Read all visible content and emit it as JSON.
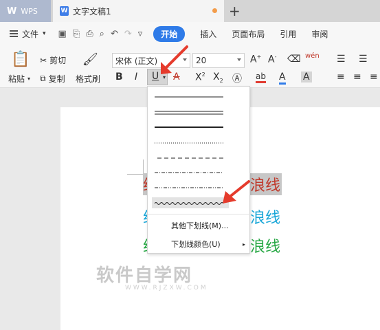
{
  "titlebar": {
    "app_tab": "WPS",
    "doc_tab": "文字文稿1",
    "doc_icon_letter": "W",
    "add_tab": "+"
  },
  "menubar": {
    "file": "文件",
    "tabs": [
      "开始",
      "插入",
      "页面布局",
      "引用",
      "审阅"
    ]
  },
  "ribbon": {
    "paste": "粘贴",
    "cut": "剪切",
    "copy": "复制",
    "format_painter": "格式刷",
    "font_name": "宋体 (正文)",
    "font_size": "20",
    "bold": "B",
    "italic": "I",
    "underline": "U",
    "phonetic": "wén"
  },
  "underline_menu": {
    "styles": [
      "single",
      "double-thin",
      "thick",
      "dotted",
      "dashed",
      "dash-dot",
      "dash-dot-dot",
      "wave"
    ],
    "more": "其他下划线(M)...",
    "color": "下划线颜色(U)"
  },
  "document": {
    "lines": [
      {
        "prefix": "给",
        "suffix": "浪线",
        "color": "#c0392b",
        "highlighted": true
      },
      {
        "prefix": "给",
        "suffix": "浪线",
        "color": "#1aa7d8",
        "highlighted": false
      },
      {
        "prefix": "给",
        "suffix": "浪线",
        "color": "#27a844",
        "highlighted": false
      }
    ]
  },
  "watermark": {
    "main": "软件自学网",
    "sub": "WWW.RJZXW.COM"
  },
  "colors": {
    "accent": "#2f7be8",
    "arrow": "#e53b2c"
  }
}
